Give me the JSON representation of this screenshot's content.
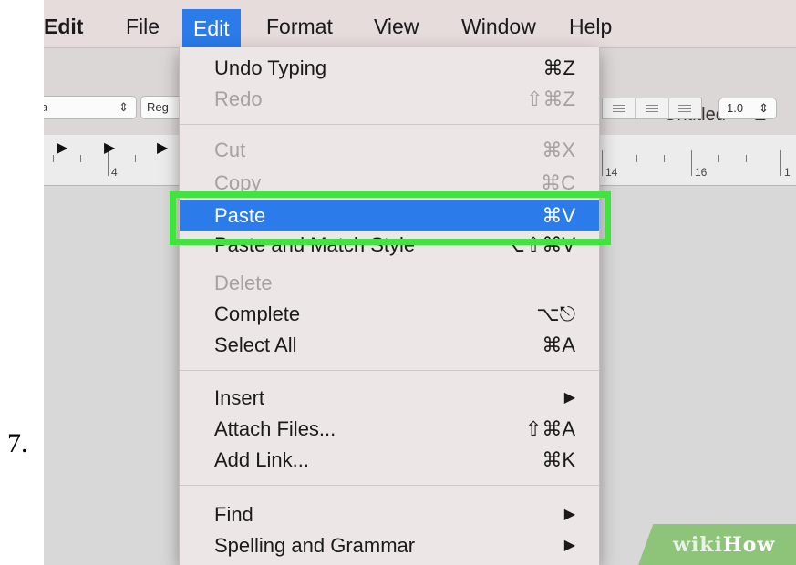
{
  "step_number": "7.",
  "menubar": {
    "items": [
      {
        "name": "menubar-app-edit",
        "label": "Edit",
        "bold": true,
        "active": false
      },
      {
        "name": "menubar-file",
        "label": "File",
        "bold": false,
        "active": false
      },
      {
        "name": "menubar-edit",
        "label": "Edit",
        "bold": false,
        "active": true
      },
      {
        "name": "menubar-format",
        "label": "Format",
        "bold": false,
        "active": false
      },
      {
        "name": "menubar-view",
        "label": "View",
        "bold": false,
        "active": false
      },
      {
        "name": "menubar-window",
        "label": "Window",
        "bold": false,
        "active": false
      },
      {
        "name": "menubar-help",
        "label": "Help",
        "bold": false,
        "active": false
      }
    ]
  },
  "toolbar": {
    "font_value": "a",
    "style_value": "Reg",
    "spacing_value": "1.0",
    "window_title": "Untitled — E"
  },
  "ruler": {
    "labels": [
      "4",
      "14",
      "16",
      "1"
    ]
  },
  "edit_menu": {
    "items": [
      {
        "type": "item",
        "name": "menu-item-undo-typing",
        "label": "Undo Typing",
        "shortcut": "⌘Z",
        "disabled": false,
        "highlighted": false
      },
      {
        "type": "item",
        "name": "menu-item-redo",
        "label": "Redo",
        "shortcut": "⇧⌘Z",
        "disabled": true,
        "highlighted": false
      },
      {
        "type": "separator"
      },
      {
        "type": "item",
        "name": "menu-item-cut",
        "label": "Cut",
        "shortcut": "⌘X",
        "disabled": true,
        "highlighted": false
      },
      {
        "type": "item",
        "name": "menu-item-copy",
        "label": "Copy",
        "shortcut": "⌘C",
        "disabled": true,
        "highlighted": false
      },
      {
        "type": "item",
        "name": "menu-item-paste",
        "label": "Paste",
        "shortcut": "⌘V",
        "disabled": false,
        "highlighted": true
      },
      {
        "type": "item",
        "name": "menu-item-paste-and-match-style",
        "label": "Paste and Match Style",
        "shortcut": "⌥⇧⌘V",
        "disabled": false,
        "highlighted": false
      },
      {
        "type": "item",
        "name": "menu-item-delete",
        "label": "Delete",
        "shortcut": "",
        "disabled": true,
        "highlighted": false
      },
      {
        "type": "item",
        "name": "menu-item-complete",
        "label": "Complete",
        "shortcut": "⌥⎋",
        "disabled": false,
        "highlighted": false
      },
      {
        "type": "item",
        "name": "menu-item-select-all",
        "label": "Select All",
        "shortcut": "⌘A",
        "disabled": false,
        "highlighted": false
      },
      {
        "type": "separator"
      },
      {
        "type": "item",
        "name": "menu-item-insert",
        "label": "Insert",
        "shortcut": "▶",
        "disabled": false,
        "highlighted": false
      },
      {
        "type": "item",
        "name": "menu-item-attach-files",
        "label": "Attach Files...",
        "shortcut": "⇧⌘A",
        "disabled": false,
        "highlighted": false
      },
      {
        "type": "item",
        "name": "menu-item-add-link",
        "label": "Add Link...",
        "shortcut": "⌘K",
        "disabled": false,
        "highlighted": false
      },
      {
        "type": "separator"
      },
      {
        "type": "item",
        "name": "menu-item-find",
        "label": "Find",
        "shortcut": "▶",
        "disabled": false,
        "highlighted": false
      },
      {
        "type": "item",
        "name": "menu-item-spelling-and-grammar",
        "label": "Spelling and Grammar",
        "shortcut": "▶",
        "disabled": false,
        "highlighted": false
      }
    ]
  },
  "watermark": {
    "part1": "wiki",
    "part2": "How"
  },
  "colors": {
    "highlight": "#2b7bea",
    "annotation": "#42e340",
    "watermark_bg": "#8ec47a"
  }
}
